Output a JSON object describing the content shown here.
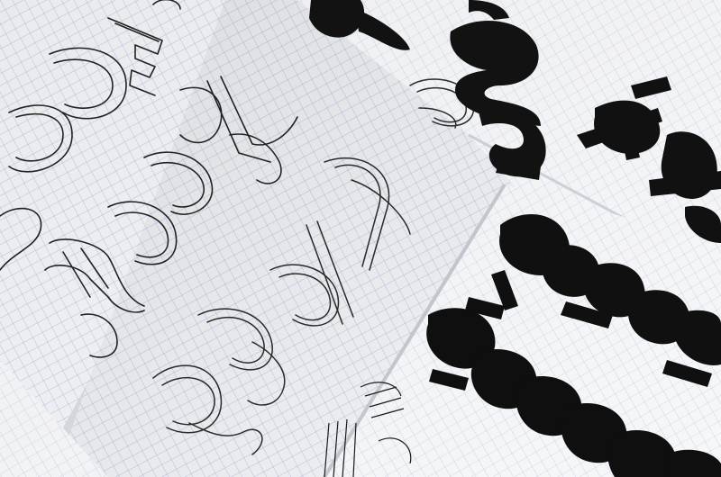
{
  "scene": {
    "description_free": true,
    "palette": {
      "paper": "#f3f4f7",
      "grid": "#9fb0d3",
      "ink": "#121212",
      "pencil": "#3a3a3a",
      "shadow": "#c9cbd2"
    },
    "sheets": [
      {
        "name": "outline-sheet-left"
      },
      {
        "name": "outline-sheet-center"
      },
      {
        "name": "filled-sheet-top-right"
      },
      {
        "name": "filled-sheet-bottom-right"
      }
    ],
    "inked_rows": [
      {
        "name": "row-top",
        "text": "a g"
      },
      {
        "name": "row-right",
        "text": "rapé"
      },
      {
        "name": "row-middle",
        "text": "qespd"
      },
      {
        "name": "row-bottom",
        "text": "desau"
      }
    ]
  }
}
